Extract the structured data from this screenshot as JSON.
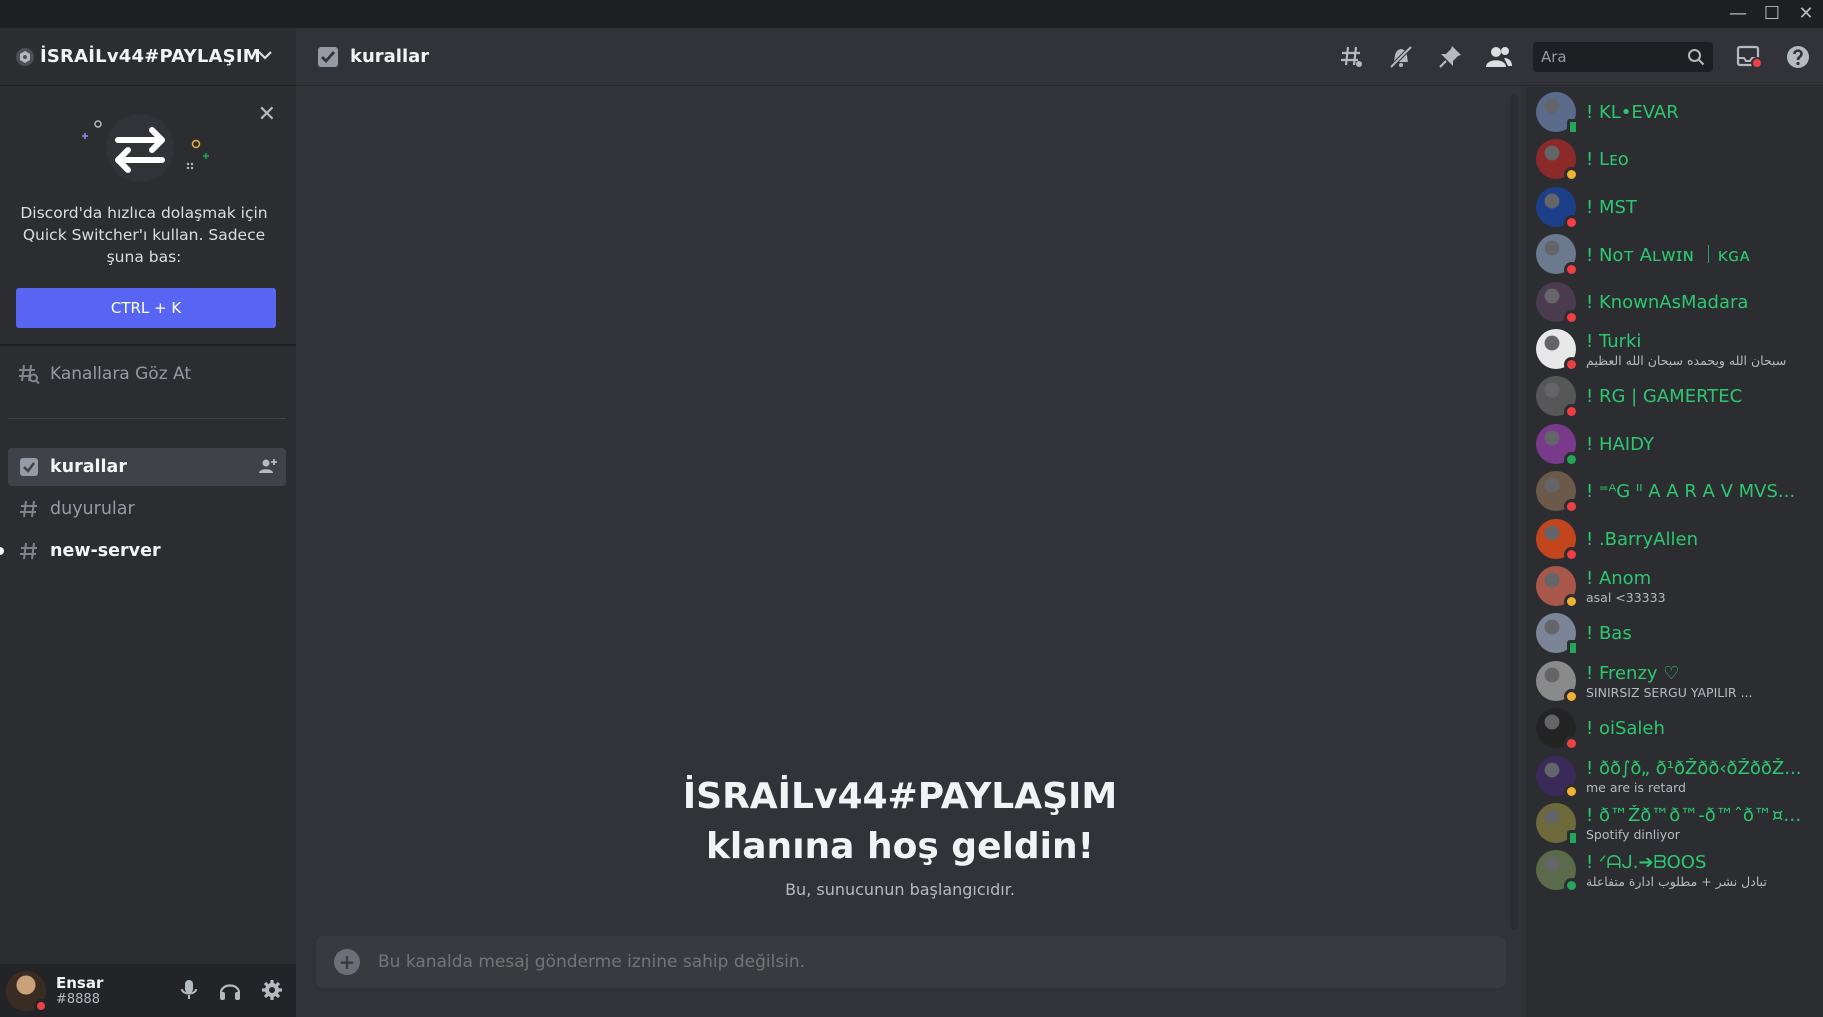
{
  "window": {
    "controls": [
      "—",
      "☐",
      "✕"
    ]
  },
  "server": {
    "name": "İSRAİLv44#PAYLAŞIM"
  },
  "quick_switcher": {
    "text": "Discord'da hızlıca dolaşmak için Quick Switcher'ı kullan. Sadece şuna bas:",
    "button": "CTRL + K"
  },
  "browse_channels": "Kanallara Göz At",
  "channels": [
    {
      "name": "kurallar",
      "icon": "rules-icon",
      "state": "active"
    },
    {
      "name": "duyurular",
      "icon": "hash-icon",
      "state": "muted"
    },
    {
      "name": "new-server",
      "icon": "hash-icon",
      "state": "unread"
    }
  ],
  "user": {
    "name": "Ensar",
    "tag": "#8888",
    "status_color": "#f23f43"
  },
  "header": {
    "channel": "kurallar",
    "search_placeholder": "Ara"
  },
  "welcome": {
    "line1": "İSRAİLv44#PAYLAŞIM",
    "line2": "klanına hoş geldin!",
    "subtitle": "Bu, sunucunun başlangıcıdır."
  },
  "composer": {
    "placeholder": "Bu kanalda mesaj gönderme iznine sahip değilsin."
  },
  "members": [
    {
      "name": "! KL•EVAR",
      "sub": "",
      "status": "mobile",
      "avatar": "#5b6b8c"
    },
    {
      "name": "! Lᴇo",
      "sub": "",
      "status": "idle",
      "avatar": "#8c2a2a"
    },
    {
      "name": "! MST",
      "sub": "",
      "status": "dnd",
      "avatar": "#1d3f8a"
    },
    {
      "name": "! Nᴏᴛ Aʟᴡɪɴ ｜ᴋɢᴀ",
      "sub": "",
      "status": "dnd",
      "avatar": "#6b7a8f"
    },
    {
      "name": "! KnownAsMadara",
      "sub": "",
      "status": "dnd",
      "avatar": "#4a3b4f"
    },
    {
      "name": "! Turki",
      "sub": "سبحان الله وبحمده سبحان الله العظيم",
      "status": "dnd",
      "avatar": "#e8e8e8"
    },
    {
      "name": "! RG | GAMERTEC",
      "sub": "",
      "status": "dnd",
      "avatar": "#575757"
    },
    {
      "name": "! HAIDY",
      "sub": "",
      "status": "online",
      "avatar": "#7a3a8c"
    },
    {
      "name": "! ⁼ᴬG ᴵᴵ A A R A V MVS...",
      "sub": "",
      "status": "dnd",
      "avatar": "#6b5a4a"
    },
    {
      "name": "! .BarryAllen",
      "sub": "",
      "status": "dnd",
      "avatar": "#c2451e"
    },
    {
      "name": "! Anom",
      "sub": "asal <33333",
      "status": "idle",
      "avatar": "#a8574a"
    },
    {
      "name": "! Bas",
      "sub": "",
      "status": "mobile",
      "avatar": "#7b8597"
    },
    {
      "name": "! Frenzy ♡",
      "sub": "SINIRSIZ SERGU YAPILIR ...",
      "status": "idle",
      "avatar": "#8a8a8a"
    },
    {
      "name": "! oiSaleh",
      "sub": "",
      "status": "dnd",
      "avatar": "#242424"
    },
    {
      "name": "! ðð∫ð„ ð¹ðŽðð‹ðŽððŽ...",
      "sub": "me are is retard",
      "status": "idle",
      "avatar": "#3a2a5a"
    },
    {
      "name": "! ð™Žð™ð™‐ð™ˆð™¤ð™Ž...",
      "sub": "Spotify dinliyor",
      "status": "mobile",
      "avatar": "#6e6a3c"
    },
    {
      "name": "! ᐟᗩᒍ.➔ᗷOOS",
      "sub": "تبادل نشر + مطلوب ادارة متفاعلة",
      "status": "online",
      "avatar": "#5a6a4a"
    }
  ]
}
